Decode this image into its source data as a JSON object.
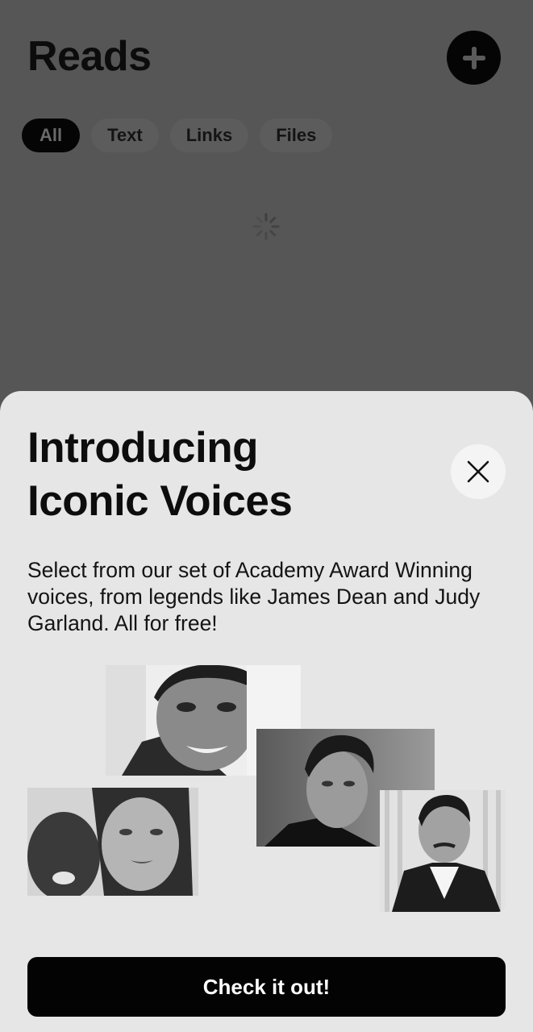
{
  "app": {
    "title": "Reads",
    "add_icon": "plus-icon",
    "filters": [
      "All",
      "Text",
      "Links",
      "Files"
    ],
    "active_filter": "All",
    "loading_icon": "spinner-icon"
  },
  "sheet": {
    "title_line_1": "Introducing",
    "title_line_2": "Iconic Voices",
    "close_icon": "close-icon",
    "description": "Select from our set of Academy Award Winning voices, from legends like James Dean and Judy Garland. All for free!",
    "cta_label": "Check it out!"
  },
  "colors": {
    "overlay_background": "#565656",
    "sheet_background": "#e6e6e6",
    "button_background": "#030303",
    "button_text": "#ffffff"
  }
}
